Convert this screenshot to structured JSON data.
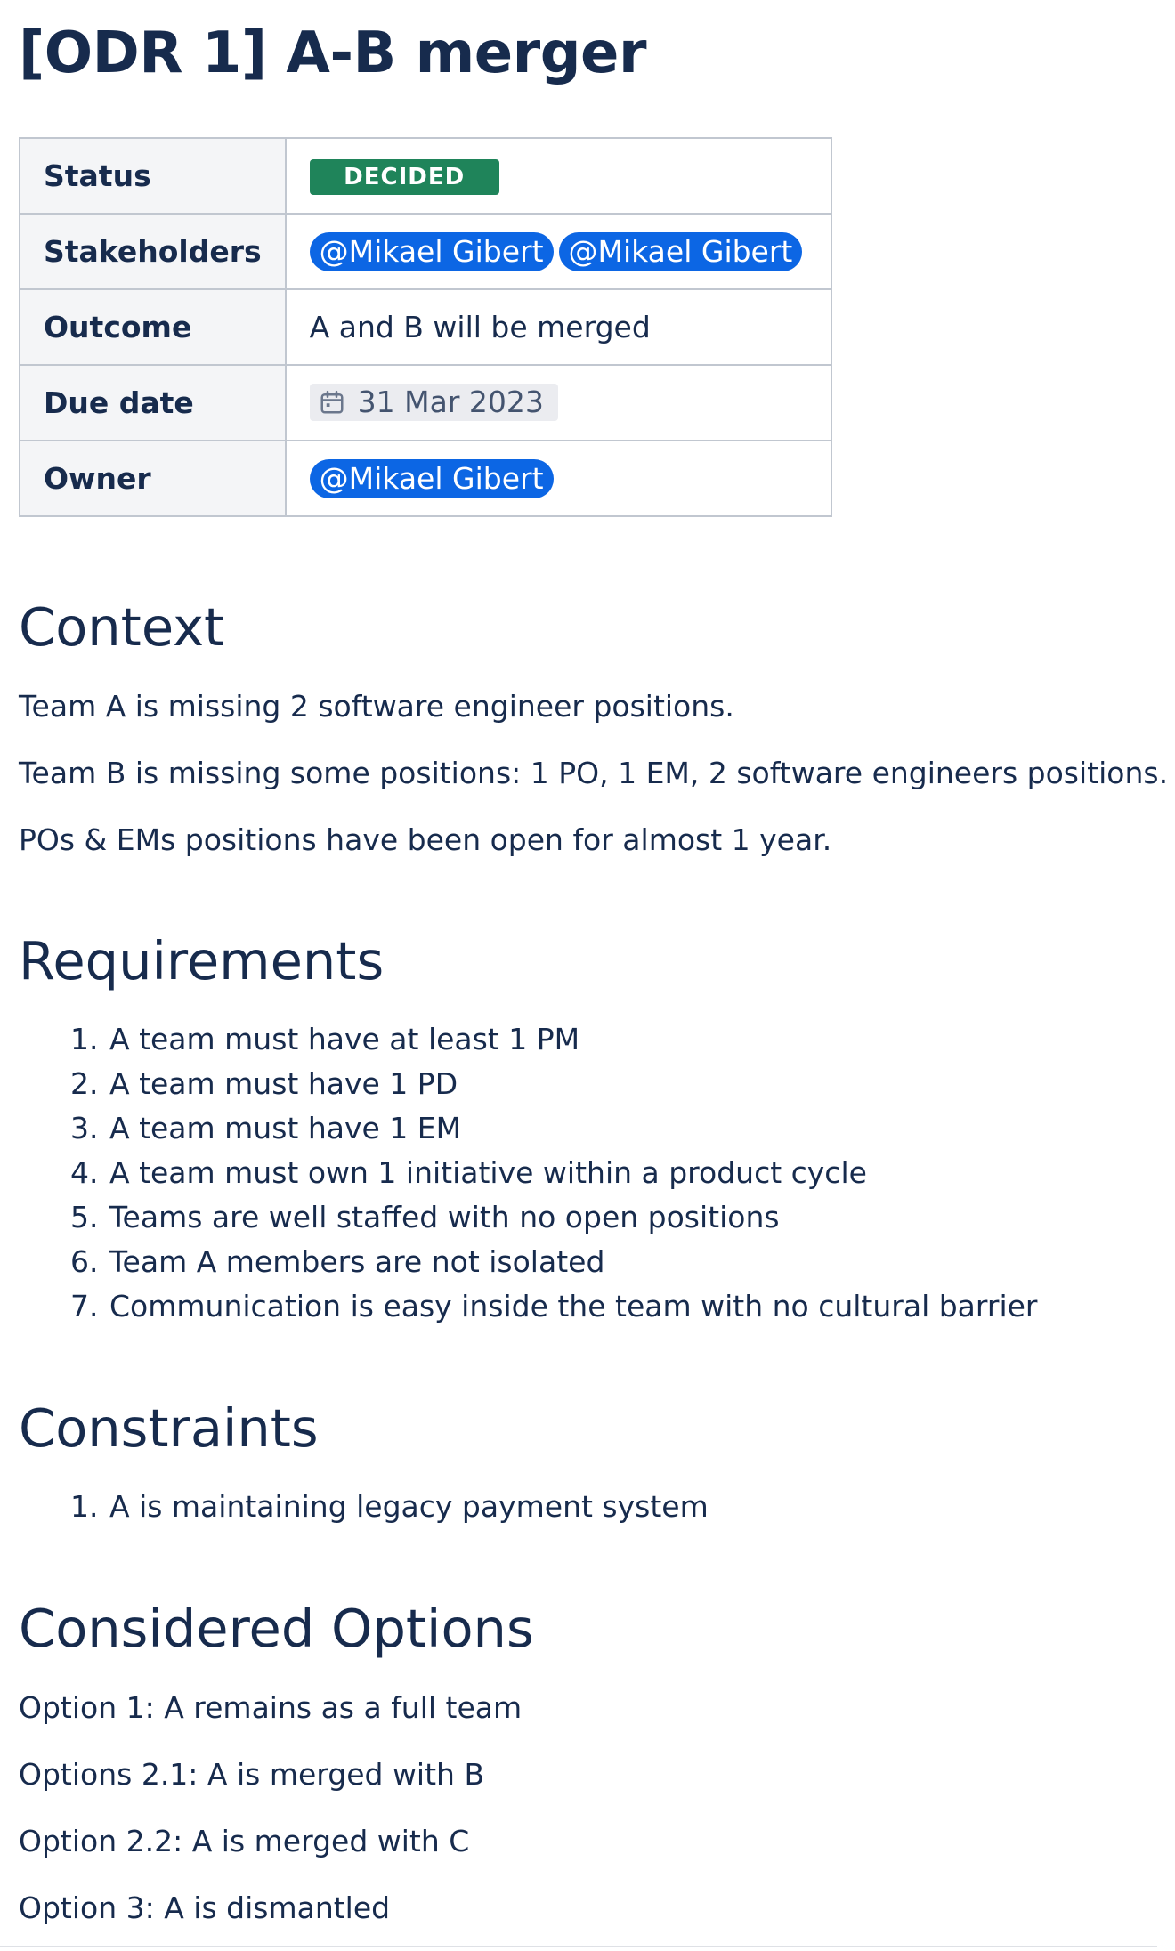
{
  "page": {
    "title": "[ODR 1] A-B merger"
  },
  "properties": {
    "status": {
      "key": "Status",
      "value": "DECIDED",
      "color": "#1f845a"
    },
    "stakeholders": {
      "key": "Stakeholders",
      "mentions": [
        "@Mikael Gibert",
        "@Mikael Gibert"
      ]
    },
    "outcome": {
      "key": "Outcome",
      "value": "A and B will be merged"
    },
    "due_date": {
      "key": "Due date",
      "value": "31 Mar 2023",
      "icon": "calendar-icon"
    },
    "owner": {
      "key": "Owner",
      "mention": "@Mikael Gibert"
    }
  },
  "context": {
    "heading": "Context",
    "paragraphs": [
      "Team A is missing 2 software engineer positions.",
      "Team B is missing some positions: 1 PO, 1 EM, 2 software engineers positions.",
      "POs & EMs positions have been open for almost 1 year."
    ]
  },
  "requirements": {
    "heading": "Requirements",
    "items": [
      "A team must have at least 1 PM",
      "A team must have 1 PD",
      "A team must have 1 EM",
      "A team must own 1 initiative within a product cycle",
      "Teams are well staffed with no open positions",
      "Team A members are not isolated",
      "Communication is easy inside the team with no cultural barrier"
    ]
  },
  "constraints": {
    "heading": "Constraints",
    "items": [
      "A is maintaining legacy payment system"
    ]
  },
  "considered_options": {
    "heading": "Considered Options",
    "options": [
      "Option 1: A remains as a full team",
      "Options 2.1: A is merged with B",
      "Option 2.2: A is merged with C",
      "Option 3: A is dismantled"
    ]
  },
  "colors": {
    "text": "#172b4d",
    "mention_bg": "#0c66e4",
    "status_bg": "#1f845a",
    "table_border": "#c1c7d0",
    "table_key_bg": "#f4f5f7",
    "date_bg": "#ebecf0"
  }
}
